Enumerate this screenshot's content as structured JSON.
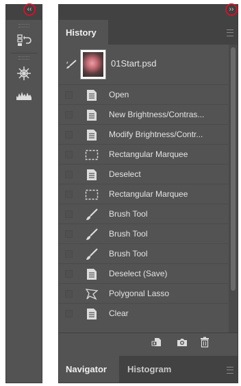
{
  "dock": {
    "collapse_glyph": "‹‹",
    "tools": [
      "history-panel-icon",
      "brush-settings-icon",
      "histogram-icon"
    ]
  },
  "panel": {
    "expand_glyph": "››",
    "history_tab": "History",
    "snapshot": {
      "label": "01Start.psd",
      "icon": "history-brush-icon"
    },
    "states": [
      {
        "label": "Open",
        "icon": "document-icon"
      },
      {
        "label": "New Brightness/Contras...",
        "icon": "document-icon"
      },
      {
        "label": "Modify Brightness/Contr...",
        "icon": "document-icon"
      },
      {
        "label": "Rectangular Marquee",
        "icon": "marquee-icon"
      },
      {
        "label": "Deselect",
        "icon": "document-icon"
      },
      {
        "label": "Rectangular Marquee",
        "icon": "marquee-icon"
      },
      {
        "label": "Brush Tool",
        "icon": "brush-icon"
      },
      {
        "label": "Brush Tool",
        "icon": "brush-icon"
      },
      {
        "label": "Brush Tool",
        "icon": "brush-icon"
      },
      {
        "label": "Deselect (Save)",
        "icon": "document-icon"
      },
      {
        "label": "Polygonal Lasso",
        "icon": "lasso-icon"
      },
      {
        "label": "Clear",
        "icon": "document-icon"
      }
    ],
    "bottom_icons": [
      "new-document-from-state-icon",
      "camera-icon",
      "trash-icon"
    ],
    "lower_tabs": [
      "Navigator",
      "Histogram"
    ]
  },
  "colors": {
    "panel_bg": "#535353",
    "dark_bg": "#424242",
    "highlight_circle": "#d0132b"
  }
}
